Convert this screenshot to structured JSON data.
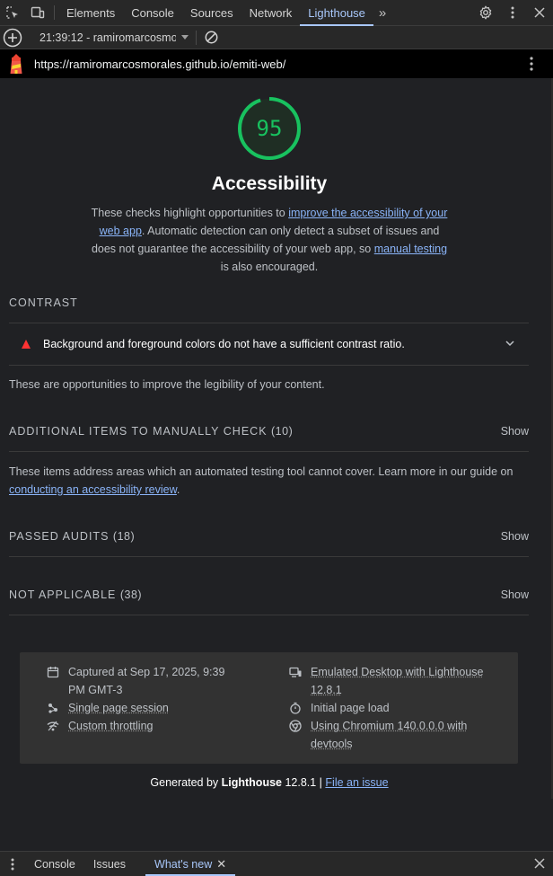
{
  "tabbar": {
    "tabs": [
      {
        "label": "Elements"
      },
      {
        "label": "Console"
      },
      {
        "label": "Sources"
      },
      {
        "label": "Network"
      },
      {
        "label": "Lighthouse"
      }
    ],
    "active_tab": "Lighthouse",
    "more_tabs": "»"
  },
  "toolbar": {
    "report_label": "21:39:12 - ramiromarcosmorales.github.io"
  },
  "urlbar": {
    "url": "https://ramiromarcosmorales.github.io/emiti-web/"
  },
  "report": {
    "score": "95",
    "score_color": "#18c25f",
    "title": "Accessibility",
    "desc_1": "These checks highlight opportunities to ",
    "desc_link_1": "improve the accessibility of your web app",
    "desc_2": ". Automatic detection can only detect a subset of issues and does not guarantee the accessibility of your web app, so ",
    "desc_link_2": "manual testing",
    "desc_3": " is also encouraged.",
    "contrast": {
      "header": "CONTRAST",
      "audit_title": "Background and foreground colors do not have a sufficient contrast ratio.",
      "description": "These are opportunities to improve the legibility of your content."
    },
    "manual": {
      "header": "ADDITIONAL ITEMS TO MANUALLY CHECK",
      "count": "(10)",
      "show": "Show",
      "desc_1": "These items address areas which an automated testing tool cannot cover. Learn more in our guide on ",
      "desc_link": "conducting an accessibility review",
      "desc_2": "."
    },
    "passed": {
      "header": "PASSED AUDITS",
      "count": "(18)",
      "show": "Show"
    },
    "not_applicable": {
      "header": "NOT APPLICABLE",
      "count": "(38)",
      "show": "Show"
    }
  },
  "env": {
    "captured": "Captured at Sep 17, 2025, 9:39 PM GMT-3",
    "session": "Single page session",
    "throttling": "Custom throttling",
    "emulated": "Emulated Desktop with Lighthouse 12.8.1",
    "initial_load": "Initial page load",
    "chromium": "Using Chromium 140.0.0.0 with devtools"
  },
  "footer": {
    "generated_by": "Generated by ",
    "product": "Lighthouse",
    "version": " 12.8.1 | ",
    "file_issue": "File an issue"
  },
  "drawer": {
    "tabs": [
      {
        "label": "Console"
      },
      {
        "label": "Issues"
      },
      {
        "label": "What's new"
      }
    ]
  }
}
